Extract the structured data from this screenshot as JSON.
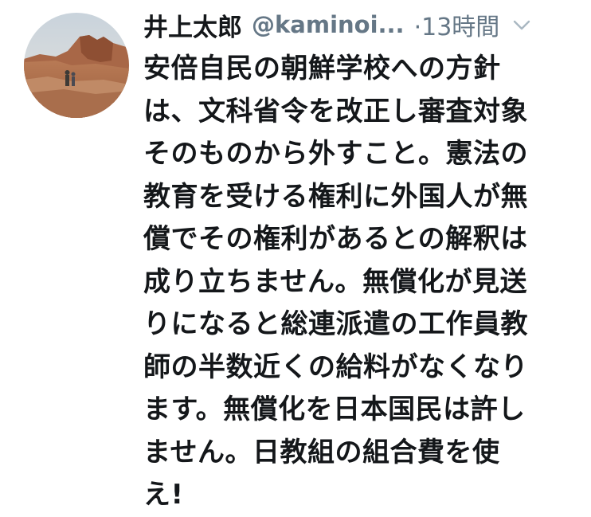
{
  "tweet": {
    "display_name": "井上太郎",
    "handle": "@kaminoi...",
    "separator_time": "·13時間",
    "avatar_icon": "profile-photo-landscape",
    "menu_icon": "chevron-down-icon",
    "text_lines": [
      "安倍自民の朝鮮学校への方針",
      "は、文科省令を改正し審査対象",
      "そのものから外すこと。憲法の",
      "教育を受ける権利に外国人が無",
      "償でその権利があるとの解釈は",
      "成り立ちません。無償化が見送",
      "りになると総連派遣の工作員教",
      "師の半数近くの給料がなくなり",
      "ます。無償化を日本国民は許し",
      "ません。日教組の組合費を使",
      "え!"
    ]
  },
  "colors": {
    "text_primary": "#14171a",
    "text_secondary": "#657786",
    "chevron": "#aab8c2",
    "background": "#ffffff"
  }
}
